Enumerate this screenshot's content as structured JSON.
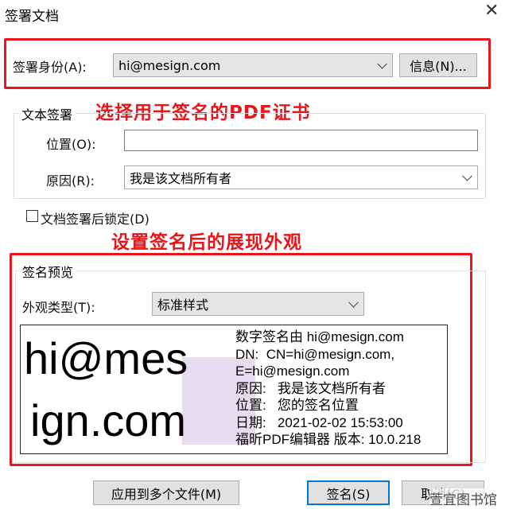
{
  "window": {
    "title": "签署文档",
    "close_glyph": "✕"
  },
  "identity": {
    "label": "签署身份(A):",
    "value": "hi@mesign.com",
    "info_button": "信息(N)..."
  },
  "annotations": {
    "choose_cert": "选择用于签名的PDF证书",
    "set_appearance": "设置签名后的展现外观"
  },
  "text_signature": {
    "group_title": "文本签署",
    "location_label": "位置(O):",
    "location_value": "",
    "reason_label": "原因(R):",
    "reason_value": "我是该文档所有者"
  },
  "lock_after_sign": {
    "label": "文档签署后锁定(D)",
    "checked": false
  },
  "preview": {
    "group_title": "签名预览",
    "appearance_label": "外观类型(T):",
    "appearance_value": "标准样式",
    "name_line1": "hi@mes",
    "name_line2": "ign.com",
    "details": [
      "数字签名由 hi@mesign.com",
      "DN:  CN=hi@mesign.com,",
      "E=hi@mesign.com",
      "原因:   我是该文档所有者",
      "位置:   您的签名位置",
      "日期:   2021-02-02 15:53:00",
      "福昕PDF编辑器 版本: 10.0.218"
    ]
  },
  "buttons": {
    "apply_multi": "应用到多个文件(M)",
    "sign": "签名(S)",
    "cancel": "取消(C)"
  },
  "watermark": "萱宜图书馆"
}
